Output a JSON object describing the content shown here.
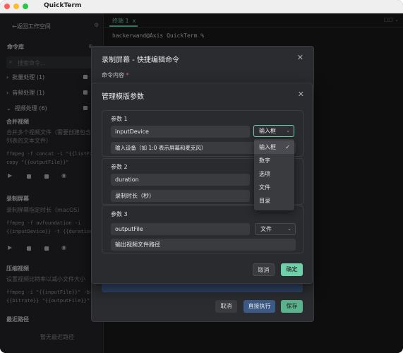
{
  "app": {
    "title": "QuickTerm"
  },
  "sidebar": {
    "back": "返回工作空间",
    "library": "命令库",
    "search_placeholder": "搜索命令...",
    "categories": [
      {
        "label": "批量处理 (1)"
      },
      {
        "label": "音频处理 (1)"
      },
      {
        "label": "视频处理 (6)"
      }
    ],
    "commands": [
      {
        "title": "合并视频",
        "desc1": "合并多个视频文件（需要创建包含文件",
        "desc2": "列表的文本文件）",
        "code1": "ffmpeg -f concat -i \"{{listFile}}\" -c",
        "code2": "copy \"{{outputFile}}\""
      },
      {
        "title": "录制屏幕",
        "desc1": "录制屏幕指定时长（macOS）",
        "code1": "ffmpeg -f avfoundation -i",
        "code2": "{{inputDevice}} -t {{duration}} -c:v"
      },
      {
        "title": "压缩视频",
        "desc1": "设置视频比特率以减小文件大小",
        "code1": "ffmpeg -i \"{{inputFile}}\" -b:v",
        "code2": "{{bitrate}} \"{{outputFile}}\""
      }
    ],
    "recent": "最近路径",
    "recent_empty": "暂无最近路径"
  },
  "terminal": {
    "tab": "终端 1",
    "tab_close": "x",
    "prompt": "hackerwand@Axis QuickTerm %"
  },
  "edit_dialog": {
    "title": "录制屏幕 - 快捷编辑命令",
    "content_label": "命令内容",
    "required": "*",
    "cancel": "取消",
    "run": "直接执行",
    "save": "保存"
  },
  "template_dialog": {
    "title": "管理模版参数",
    "params": [
      {
        "header": "参数 1",
        "name": "inputDevice",
        "type": "输入框",
        "desc": "输入设备（如 1:0 表示屏幕和麦克风）"
      },
      {
        "header": "参数 2",
        "name": "duration",
        "type": "",
        "desc": "录制时长（秒）"
      },
      {
        "header": "参数 3",
        "name": "outputFile",
        "type": "文件",
        "desc": "输出视频文件路径"
      }
    ],
    "type_options": [
      {
        "label": "输入框",
        "selected": true
      },
      {
        "label": "数字"
      },
      {
        "label": "选项"
      },
      {
        "label": "文件"
      },
      {
        "label": "目录"
      }
    ],
    "cancel": "取消",
    "ok": "确定"
  },
  "colors": {
    "accent": "#6fcfa8",
    "primary_btn": "#3d5a86",
    "save_btn": "#5bb38d"
  }
}
